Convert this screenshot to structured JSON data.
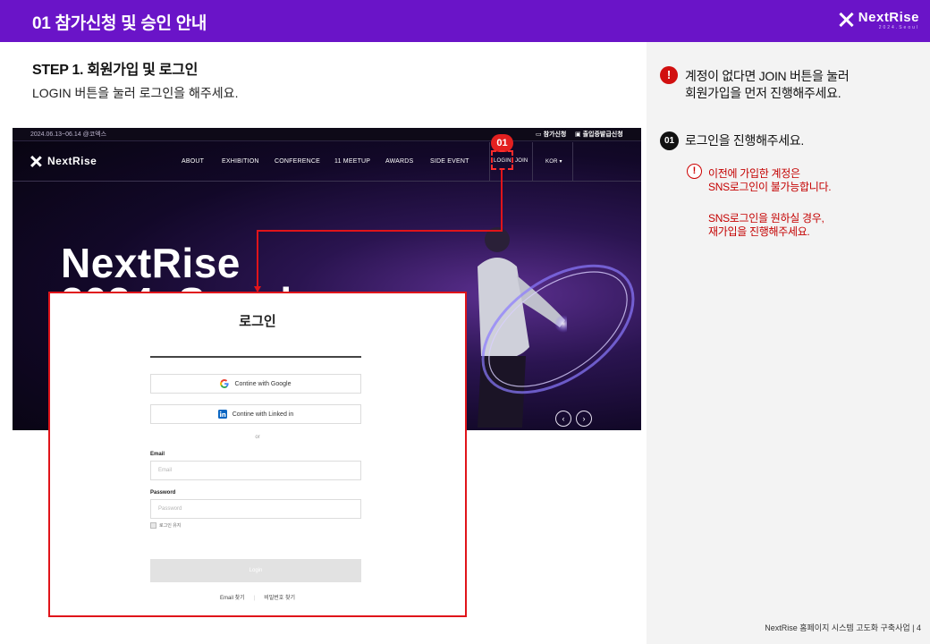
{
  "header": {
    "title": "01 참가신청 및 승인 안내",
    "brand_name": "NextRise",
    "brand_sub": "2024.Seoul"
  },
  "step": {
    "title": "STEP 1. 회원가입 및 로그인",
    "desc": "LOGIN 버튼을 눌러 로그인을 해주세요."
  },
  "side": {
    "notice_line1": "계정이 없다면 JOIN 버튼을 눌러",
    "notice_line2": "회원가입을 먼저 진행해주세요.",
    "step_number": "01",
    "step_text": "로그인을 진행해주세요.",
    "note_line1": "이전에 가입한 계정은",
    "note_line2": "SNS로그인이 불가능합니다.",
    "note_line3": "SNS로그인을 원하실 경우,",
    "note_line4": "재가입을 진행해주세요."
  },
  "site": {
    "date": "2024.06.13~06.14 @코엑스",
    "utility_1": "참가신청",
    "utility_2": "출입증발급신청",
    "logo": "NextRise",
    "nav": [
      "ABOUT",
      "EXHIBITION",
      "CONFERENCE",
      "11 MEETUP",
      "AWARDS",
      "SIDE EVENT"
    ],
    "login": "LOGIN",
    "join": "JOIN",
    "lang": "KOR",
    "hero_line1": "NextRise",
    "hero_line2": "2024, Seoul",
    "prev": "‹",
    "next": "›"
  },
  "callout": {
    "label": "01"
  },
  "login_modal": {
    "title": "로그인",
    "google_label": "Contine with Google",
    "linkedin_label": "Contine with Linked in",
    "or": "or",
    "email_label": "Email",
    "email_placeholder": "Email",
    "password_label": "Password",
    "password_placeholder": "Password",
    "remember": "로그인 유지",
    "login_button": "Login",
    "find_email": "Email 찾기",
    "find_password": "비밀번호 찾기"
  },
  "footer": "NextRise 홈페이지 시스템 고도화 구축사업 | 4",
  "colors": {
    "header_bg": "#6a14c8",
    "accent_red": "#e0141a",
    "note_red": "#c40000"
  }
}
